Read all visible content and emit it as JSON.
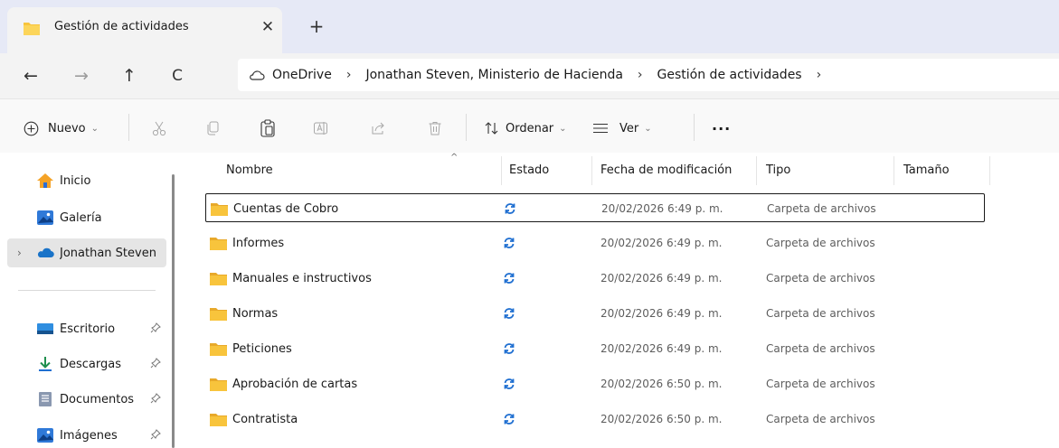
{
  "tab": {
    "title": "Gestión de actividades",
    "close_glyph": "✕",
    "new_tab_glyph": "+"
  },
  "nav_buttons": {
    "back": "←",
    "forward": "→",
    "up": "↑",
    "refresh": "C"
  },
  "address": {
    "crumbs": [
      "OneDrive",
      "Jonathan Steven, Ministerio de Hacienda",
      "Gestión de actividades"
    ],
    "separator": "›"
  },
  "toolbar": {
    "new_label": "Nuevo",
    "sort_label": "Ordenar",
    "view_label": "Ver",
    "more_label": "···",
    "chevron": "⌄",
    "icons": [
      "plus-circle-icon",
      "cut-icon",
      "copy-icon",
      "paste-icon",
      "rename-icon",
      "share-icon",
      "delete-icon",
      "sort-icon",
      "view-icon"
    ]
  },
  "sidebar": {
    "items": [
      {
        "label": "Inicio",
        "icon": "home-icon"
      },
      {
        "label": "Galería",
        "icon": "gallery-icon"
      },
      {
        "label": "Jonathan Steven",
        "icon": "onedrive-cloud-icon"
      },
      {
        "label": "Escritorio",
        "icon": "desktop-icon"
      },
      {
        "label": "Descargas",
        "icon": "download-icon"
      },
      {
        "label": "Documentos",
        "icon": "documents-icon"
      },
      {
        "label": "Imágenes",
        "icon": "pictures-icon"
      }
    ],
    "pin_glyph": "📌",
    "expand_glyph": "›"
  },
  "columns": {
    "name": "Nombre",
    "status": "Estado",
    "date": "Fecha de modificación",
    "type": "Tipo",
    "size": "Tamaño",
    "sort_indicator": "^"
  },
  "files": [
    {
      "name": "Cuentas de Cobro",
      "date": "20/02/2026 6:49 p. m.",
      "type": "Carpeta de archivos",
      "status": "sync-icon"
    },
    {
      "name": "Informes",
      "date": "20/02/2026 6:49 p. m.",
      "type": "Carpeta de archivos",
      "status": "sync-icon"
    },
    {
      "name": "Manuales e instructivos",
      "date": "20/02/2026 6:49 p. m.",
      "type": "Carpeta de archivos",
      "status": "sync-icon"
    },
    {
      "name": "Normas",
      "date": "20/02/2026 6:49 p. m.",
      "type": "Carpeta de archivos",
      "status": "sync-icon"
    },
    {
      "name": "Peticiones",
      "date": "20/02/2026 6:49 p. m.",
      "type": "Carpeta de archivos",
      "status": "sync-icon"
    },
    {
      "name": "Aprobación de cartas",
      "date": "20/02/2026 6:50 p. m.",
      "type": "Carpeta de archivos",
      "status": "sync-icon"
    },
    {
      "name": "Contratista",
      "date": "20/02/2026 6:50 p. m.",
      "type": "Carpeta de archivos",
      "status": "sync-icon"
    }
  ],
  "colors": {
    "folder": "#f8c43c",
    "sync": "#1f6fd1",
    "onedrive": "#1a73c8",
    "tabstrip": "#e6e9f6"
  }
}
